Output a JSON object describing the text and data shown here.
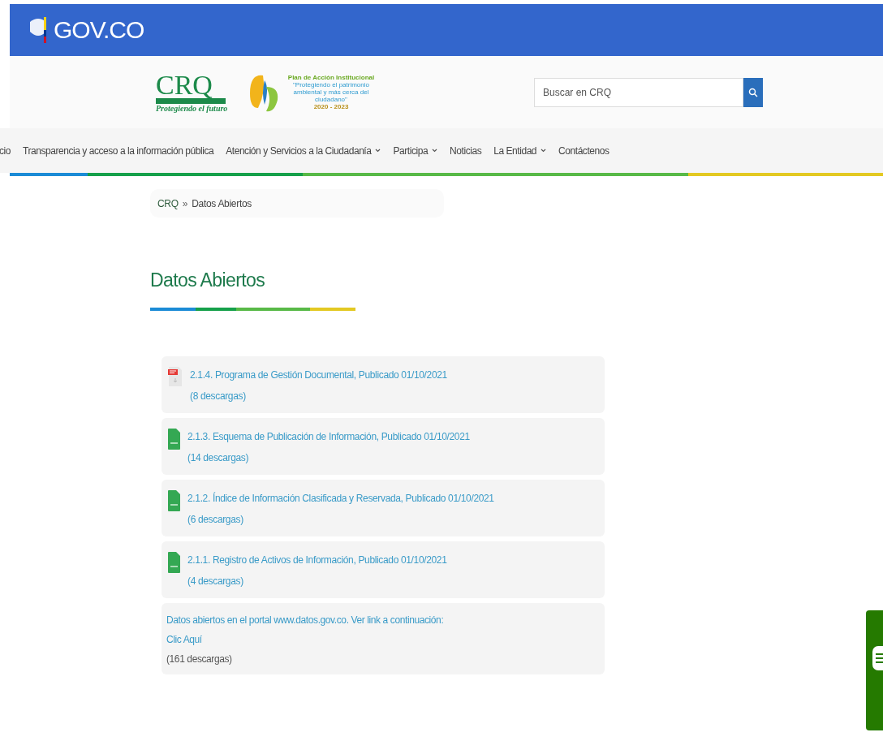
{
  "header": {
    "brand": "GOV.CO"
  },
  "logos": {
    "crq": {
      "letters": "CRQ",
      "motto": "Protegiendo el futuro"
    },
    "plan": {
      "title": "Plan de Acción Institucional",
      "quote": "\"Protegiendo el patrimonio ambiental y más cerca del ciudadano\"",
      "years": "2020 - 2023"
    }
  },
  "search": {
    "placeholder": "Buscar en CRQ"
  },
  "nav": [
    {
      "label": "cio",
      "has_dropdown": false
    },
    {
      "label": "Transparencia y acceso a la información pública",
      "has_dropdown": false
    },
    {
      "label": "Atención y Servicios a la Ciudadanía",
      "has_dropdown": true
    },
    {
      "label": "Participa",
      "has_dropdown": true
    },
    {
      "label": "Noticias",
      "has_dropdown": false
    },
    {
      "label": "La Entidad",
      "has_dropdown": true
    },
    {
      "label": "Contáctenos",
      "has_dropdown": false
    }
  ],
  "breadcrumb": {
    "items": [
      "CRQ",
      "Datos Abiertos"
    ],
    "separator": "»"
  },
  "title": "Datos Abiertos",
  "files": [
    {
      "kind": "pdf",
      "title": "2.1.4. Programa de Gestión Documental, Publicado 01/10/2021",
      "downloads": "(8 descargas)"
    },
    {
      "kind": "xlsx",
      "title": "2.1.3. Esquema de Publicación de Información, Publicado 01/10/2021",
      "downloads": "(14 descargas)"
    },
    {
      "kind": "xlsx",
      "title": "2.1.2. Índice de Información Clasificada y Reservada, Publicado 01/10/2021",
      "downloads": "(6 descargas)"
    },
    {
      "kind": "xlsx",
      "title": "2.1.1. Registro de Activos de Información, Publicado 01/10/2021",
      "downloads": "(4 descargas)"
    }
  ],
  "portal": {
    "text": "Datos abiertos en el portal www.datos.gov.co. Ver link a continuación:",
    "link": "Clic Aquí",
    "downloads": "(161 descargas)"
  }
}
